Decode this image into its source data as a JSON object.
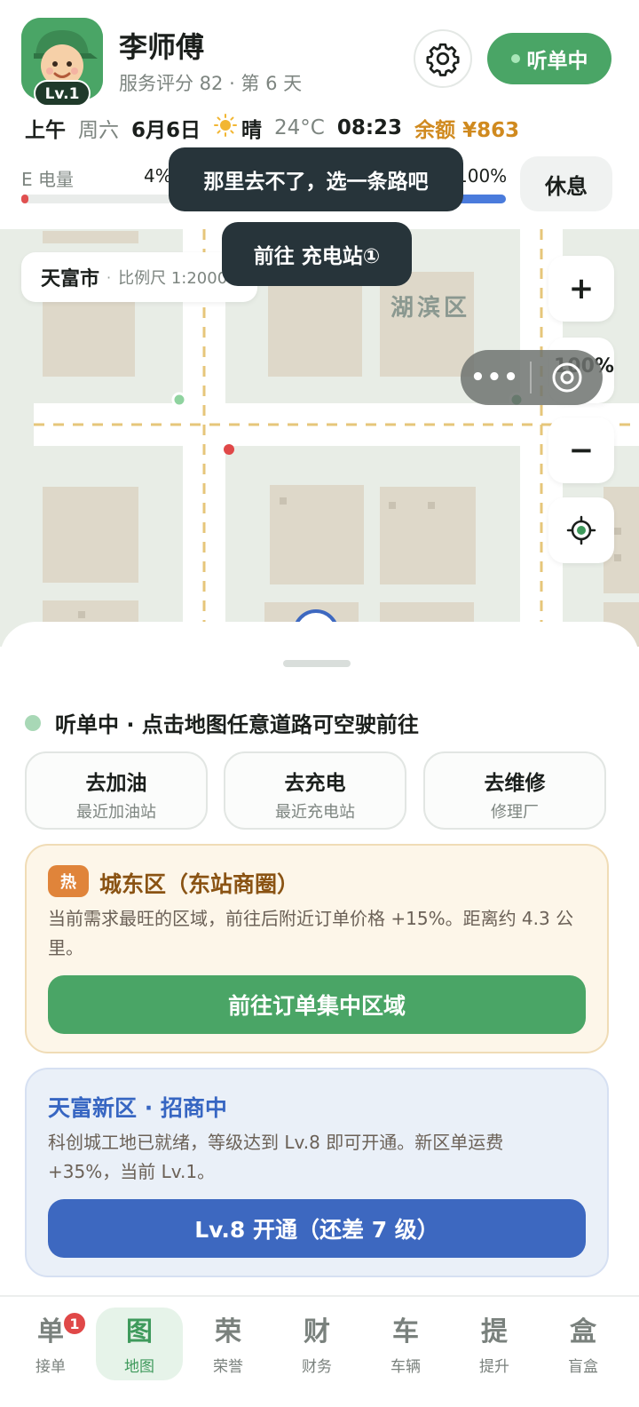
{
  "header": {
    "driver_name": "李师傅",
    "level_badge": "Lv.1",
    "subline": "服务评分 82 · 第 6 天",
    "status_pill": "听单中",
    "ampm": "上午",
    "weekday": "周六",
    "date": "6月6日",
    "weather": "晴",
    "temperature": "24°C",
    "time": "08:23",
    "balance": "余额 ¥863",
    "energy_label": "E 电量",
    "energy_percent_text": "4%",
    "energy_value": 0.04,
    "bar3_percent_text": "100%",
    "bar3_value": 1.0,
    "rest_button": "休息"
  },
  "toasts": {
    "route_warning": "那里去不了，选一条路吧",
    "heading": "前往 充电站①"
  },
  "map": {
    "city": "天富市",
    "scale_sep": "·",
    "scale": "比例尺 1:20000",
    "district": "湖滨区",
    "zoom_in": "+",
    "zoom_out": "−",
    "zoom_level": "100%",
    "more_dots": "•••"
  },
  "sheet": {
    "status_text": "听单中 · 点击地图任意道路可空驶前往",
    "quick_actions": [
      {
        "title": "去加油",
        "sub": "最近加油站"
      },
      {
        "title": "去充电",
        "sub": "最近充电站"
      },
      {
        "title": "去维修",
        "sub": "修理厂"
      }
    ],
    "hot_card": {
      "tag": "热",
      "title": "城东区（东站商圈）",
      "desc": "当前需求最旺的区域，前往后附近订单价格 +15%。距离约 4.3 公里。",
      "button": "前往订单集中区域"
    },
    "new_card": {
      "title": "天富新区 · 招商中",
      "desc": "科创城工地已就绪，等级达到 Lv.8 即可开通。新区单运费 +35%，当前 Lv.1。",
      "button": "Lv.8 开通（还差 7 级）"
    }
  },
  "tabs": [
    {
      "glyph": "单",
      "label": "接单",
      "badge": "1"
    },
    {
      "glyph": "图",
      "label": "地图"
    },
    {
      "glyph": "荣",
      "label": "荣誉"
    },
    {
      "glyph": "财",
      "label": "财务"
    },
    {
      "glyph": "车",
      "label": "车辆"
    },
    {
      "glyph": "提",
      "label": "提升"
    },
    {
      "glyph": "盒",
      "label": "盲盒"
    }
  ],
  "colors": {
    "accent_green": "#4aa566",
    "balance_orange": "#d08a1f",
    "blue_button": "#3d68c0",
    "hot_tag": "#e0843a"
  }
}
